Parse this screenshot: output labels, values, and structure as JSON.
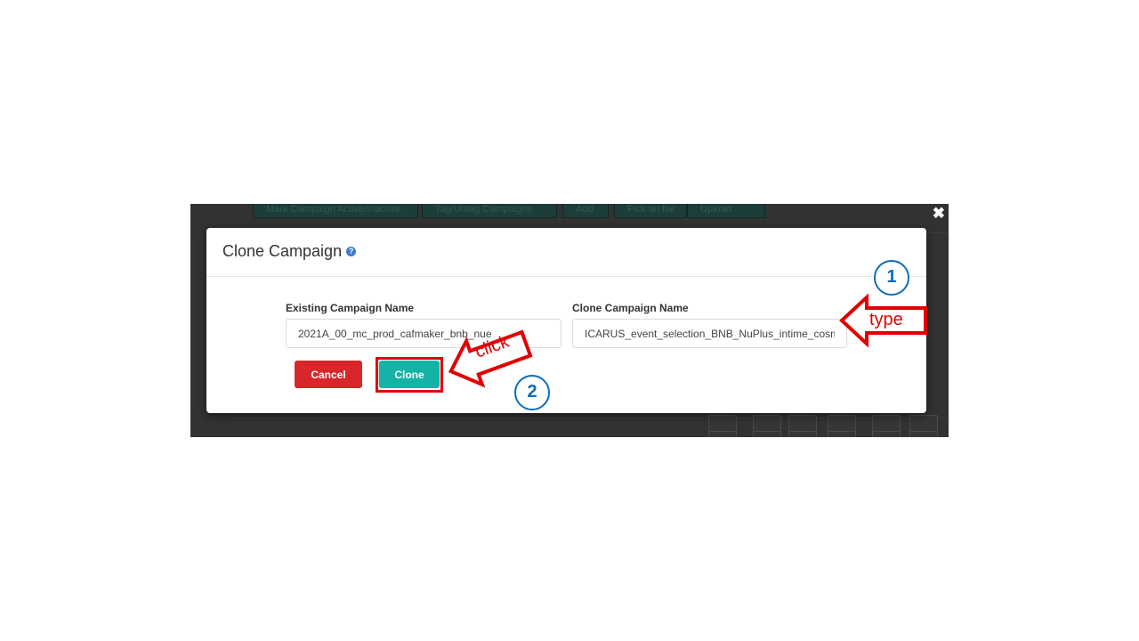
{
  "modal": {
    "title": "Clone Campaign",
    "help_icon": "question-circle-icon",
    "existing_label": "Existing Campaign Name",
    "existing_value": "2021A_00_mc_prod_cafmaker_bnb_nue",
    "clone_label": "Clone Campaign Name",
    "clone_value": "ICARUS_event_selection_BNB_NuPlus_intime_cosmics",
    "cancel_label": "Cancel",
    "clone_button_label": "Clone",
    "close_glyph": "✖"
  },
  "background": {
    "toolbar_buttons": [
      "Mark Campaign Active/Inactive",
      "Tag/Untag Campaigns",
      "Add",
      "Pick an file",
      "Upload"
    ]
  },
  "annotations": {
    "step1_number": "1",
    "step1_text": "type",
    "step2_number": "2",
    "step2_text": "click"
  },
  "colors": {
    "annotation_red": "#e00000",
    "step_blue": "#0a6ebd",
    "cancel_red": "#d9262a",
    "clone_teal": "#14b3a6"
  }
}
